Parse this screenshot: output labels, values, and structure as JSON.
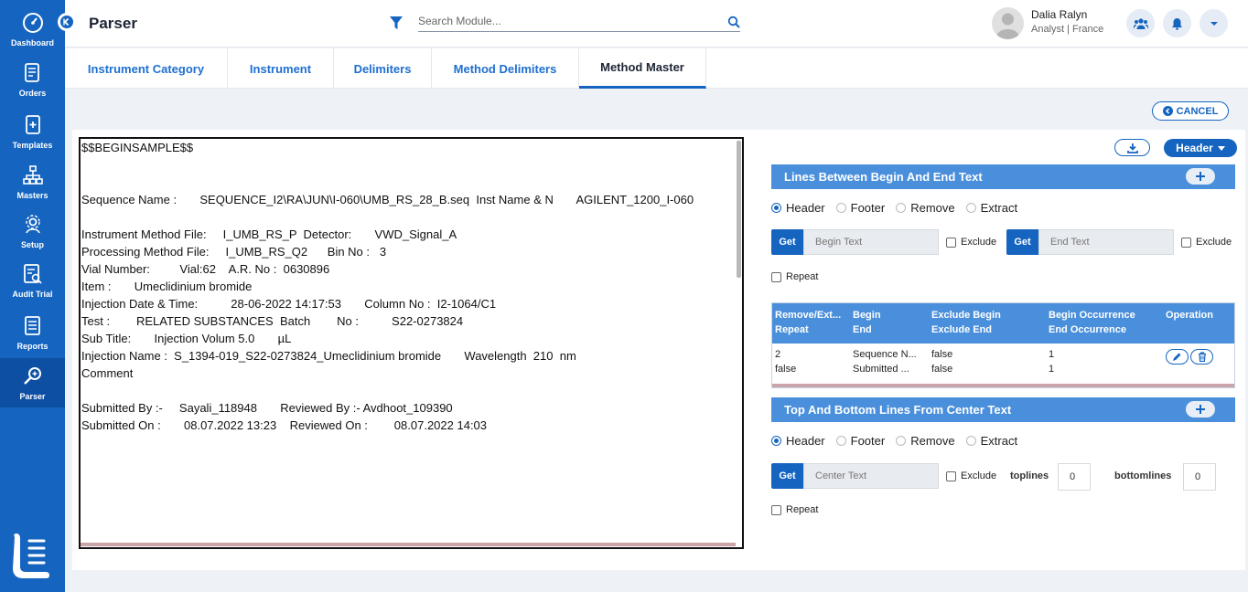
{
  "sidebar": {
    "items": [
      {
        "label": "Dashboard",
        "icon": "dashboard-icon"
      },
      {
        "label": "Orders",
        "icon": "orders-icon"
      },
      {
        "label": "Templates",
        "icon": "templates-icon"
      },
      {
        "label": "Masters",
        "icon": "masters-icon"
      },
      {
        "label": "Setup",
        "icon": "setup-icon"
      },
      {
        "label": "Audit Trial",
        "icon": "audit-icon"
      },
      {
        "label": "Reports",
        "icon": "reports-icon"
      },
      {
        "label": "Parser",
        "icon": "parser-icon"
      }
    ]
  },
  "header": {
    "title": "Parser",
    "search_placeholder": "Search Module...",
    "user_name": "Dalia Ralyn",
    "user_role": "Analyst | France"
  },
  "tabs": [
    "Instrument Category",
    "Instrument",
    "Delimiters",
    "Method Delimiters",
    "Method Master"
  ],
  "actions": {
    "cancel": "CANCEL",
    "header_dropdown": "Header"
  },
  "viewer": {
    "text": "$$BEGINSAMPLE$$\n\n\nSequence Name :       SEQUENCE_I2\\RA\\JUN\\I-060\\UMB_RS_28_B.seq  Inst Name & N       AGILENT_1200_I-060\n\nInstrument Method File:     I_UMB_RS_P  Detector:       VWD_Signal_A\nProcessing Method File:     I_UMB_RS_Q2      Bin No :   3\nVial Number:         Vial:62    A.R. No :  0630896\nItem :       Umeclidinium bromide\nInjection Date & Time:          28-06-2022 14:17:53       Column No :  I2-1064/C1\nTest :        RELATED SUBSTANCES  Batch        No :          S22-0273824\nSub Title:       Injection Volum 5.0       µL\nInjection Name :  S_1394-019_S22-0273824_Umeclidinium bromide       Wavelength  210  nm\nComment\n\nSubmitted By :-     Sayali_118948       Reviewed By :- Avdhoot_109390\nSubmitted On :       08.07.2022 13:23    Reviewed On :        08.07.2022 14:03\n\n\n\n\n\n\n\nPeak No       Ret Time       Peak Name    Peak Type      TYPE         Area          Height     Area        RRT  %"
  },
  "section1": {
    "title": "Lines Between Begin And End Text",
    "radios": [
      "Header",
      "Footer",
      "Remove",
      "Extract"
    ],
    "selected": "Header",
    "get_label": "Get",
    "begin_placeholder": "Begin Text",
    "end_placeholder": "End Text",
    "exclude_label": "Exclude",
    "repeat_label": "Repeat"
  },
  "table": {
    "headers": [
      [
        "Remove/Ext...",
        "Repeat"
      ],
      [
        "Begin",
        "End"
      ],
      [
        "Exclude Begin",
        "Exclude End"
      ],
      [
        "Begin Occurrence",
        "End Occurrence"
      ],
      [
        "Operation"
      ]
    ],
    "row": [
      [
        "2",
        "false"
      ],
      [
        "Sequence N...",
        "Submitted ..."
      ],
      [
        "false",
        "false"
      ],
      [
        "1",
        "1"
      ]
    ]
  },
  "section2": {
    "title": "Top And Bottom Lines From Center Text",
    "radios": [
      "Header",
      "Footer",
      "Remove",
      "Extract"
    ],
    "selected": "Header",
    "get_label": "Get",
    "center_placeholder": "Center Text",
    "exclude_label": "Exclude",
    "toplines_label": "toplines",
    "toplines_value": "0",
    "bottomlines_label": "bottomlines",
    "bottomlines_value": "0",
    "repeat_label": "Repeat"
  },
  "colors": {
    "primary": "#1565c0",
    "section_bar": "#4a8fdb"
  }
}
